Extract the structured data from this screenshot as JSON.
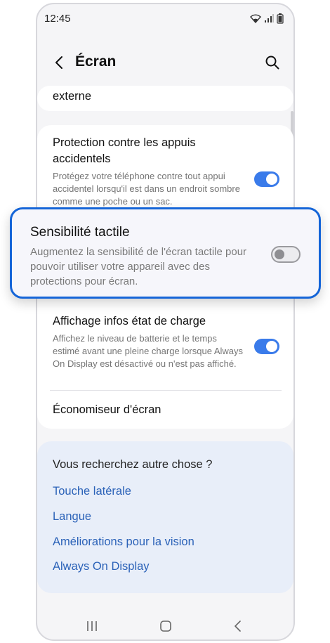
{
  "status_bar": {
    "time": "12:45"
  },
  "header": {
    "title": "Écran"
  },
  "partial_item": {
    "title": "externe"
  },
  "settings": {
    "protection": {
      "title": "Protection contre les appuis accidentels",
      "description": "Protégez votre téléphone contre tout appui accidentel lorsqu'il est dans un endroit sombre comme une poche ou un sac.",
      "enabled": true
    },
    "touch_sensitivity": {
      "title": "Sensibilité tactile",
      "description": "Augmentez la sensibilité de l'écran tactile pour pouvoir utiliser votre appareil avec des protections pour écran.",
      "enabled": false
    },
    "charging_info": {
      "title": "Affichage infos état de charge",
      "description": "Affichez le niveau de batterie et le temps estimé avant une pleine charge lorsque Always On Display est désactivé ou n'est pas affiché.",
      "enabled": true
    },
    "screen_saver": {
      "title": "Économiseur d'écran"
    }
  },
  "suggestions": {
    "title": "Vous recherchez autre chose ?",
    "links": [
      "Touche latérale",
      "Langue",
      "Améliorations pour la vision",
      "Always On Display"
    ]
  },
  "colors": {
    "accent": "#3a7bea",
    "link": "#2b62b8",
    "highlight_border": "#1565d8"
  },
  "icons": {
    "back": "chevron-left-icon",
    "search": "search-icon",
    "wifi": "wifi-icon",
    "signal": "signal-icon",
    "battery": "battery-icon",
    "nav_recents": "recents-icon",
    "nav_home": "home-icon",
    "nav_back": "back-icon"
  }
}
